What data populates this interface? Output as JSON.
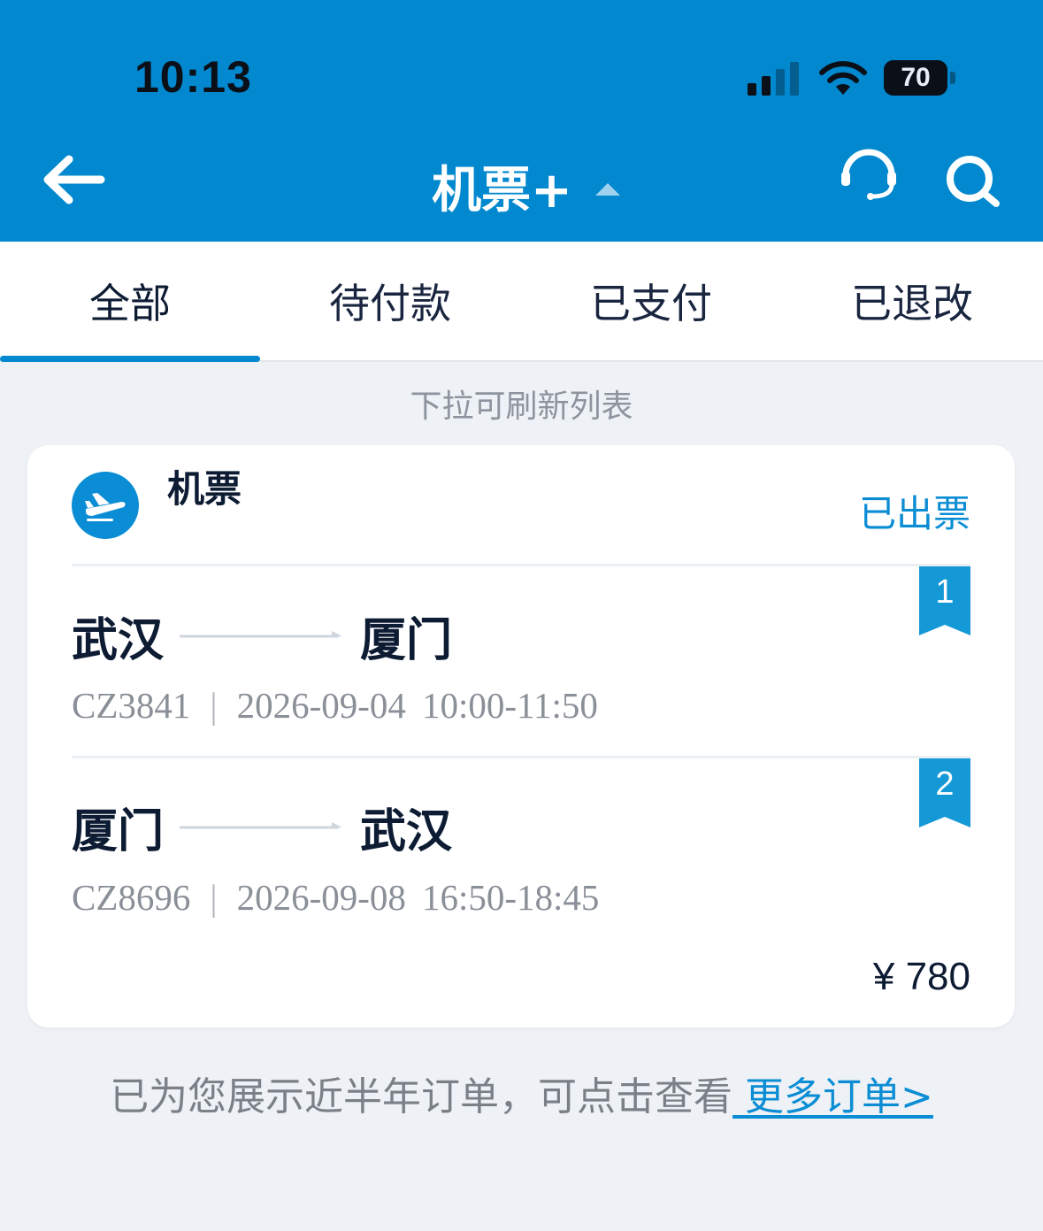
{
  "status_bar": {
    "time": "10:13",
    "battery": "70"
  },
  "nav": {
    "title": "机票+"
  },
  "tabs": [
    {
      "label": "全部",
      "active": true
    },
    {
      "label": "待付款",
      "active": false
    },
    {
      "label": "已支付",
      "active": false
    },
    {
      "label": "已退改",
      "active": false
    }
  ],
  "refresh_hint": "下拉可刷新列表",
  "order": {
    "category": "机票",
    "status": "已出票",
    "segments": [
      {
        "badge": "1",
        "from": "武汉",
        "to": "厦门",
        "flight": "CZ3841",
        "date": "2026-09-04",
        "time": "10:00-11:50"
      },
      {
        "badge": "2",
        "from": "厦门",
        "to": "武汉",
        "flight": "CZ8696",
        "date": "2026-09-08",
        "time": "16:50-18:45"
      }
    ],
    "price": "¥ 780"
  },
  "footer": {
    "note": "已为您展示近半年订单，可点击查看",
    "link": " 更多订单>"
  },
  "colors": {
    "primary": "#0288cf",
    "accent": "#0a8dd4",
    "background": "#eef1f5",
    "text_dark": "#0d1b33",
    "text_muted": "#8a8f98"
  }
}
